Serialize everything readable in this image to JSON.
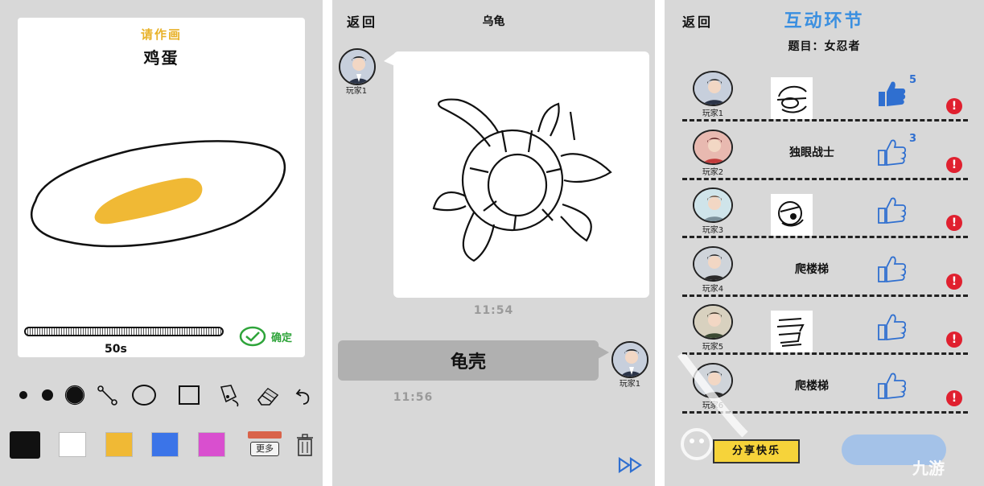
{
  "panel1": {
    "prompt": "请作画",
    "word": "鸡蛋",
    "timer": "50s",
    "confirm": "确定",
    "more_label": "更多",
    "tools": [
      "dot-small-icon",
      "dot-medium-icon",
      "dot-large-icon",
      "line-icon",
      "circle-icon",
      "square-icon",
      "fill-bucket-icon",
      "eraser-icon",
      "undo-icon"
    ],
    "colors": [
      "#111111",
      "#ffffff",
      "#f0b935",
      "#3b74e8",
      "#d94fcf"
    ]
  },
  "panel2": {
    "back": "返回",
    "title": "乌龟",
    "player": "玩家1",
    "time1": "11:54",
    "answer": "龟壳",
    "player2": "玩家1",
    "time2": "11:56"
  },
  "panel3": {
    "back": "返回",
    "title": "互动环节",
    "topic": "题目：女忍者",
    "rows": [
      {
        "player": "玩家1",
        "answer": "",
        "likes": "5"
      },
      {
        "player": "玩家2",
        "answer": "独眼战士",
        "likes": "3"
      },
      {
        "player": "玩家3",
        "answer": "",
        "likes": ""
      },
      {
        "player": "玩家4",
        "answer": "爬楼梯",
        "likes": ""
      },
      {
        "player": "玩家5",
        "answer": "",
        "likes": ""
      },
      {
        "player": "玩家6",
        "answer": "爬楼梯",
        "likes": ""
      }
    ],
    "happy": "分享快乐",
    "watermark": "九游"
  }
}
